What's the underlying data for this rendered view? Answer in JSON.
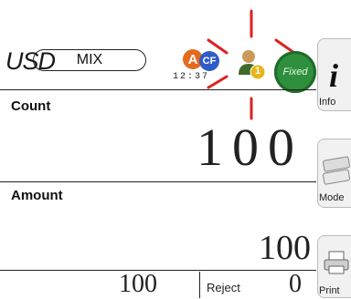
{
  "status": {
    "currency": "USD",
    "mode": "MIX",
    "badge_a": "A",
    "badge_cf": "CF",
    "user_badge": "1",
    "time": "12:37",
    "fixed": "Fixed"
  },
  "count": {
    "label": "Count",
    "value": "100"
  },
  "amount": {
    "label": "Amount",
    "value": "100"
  },
  "bottom": {
    "value": "100",
    "reject_label": "Reject",
    "reject_value": "0"
  },
  "side": {
    "info_label": "Info",
    "mode_label": "Mode",
    "print_label": "Print"
  },
  "colors": {
    "badge_a": "#e56a1f",
    "badge_cf": "#2f5cc9",
    "fixed": "#2e8f3d",
    "highlight": "#e02020"
  }
}
